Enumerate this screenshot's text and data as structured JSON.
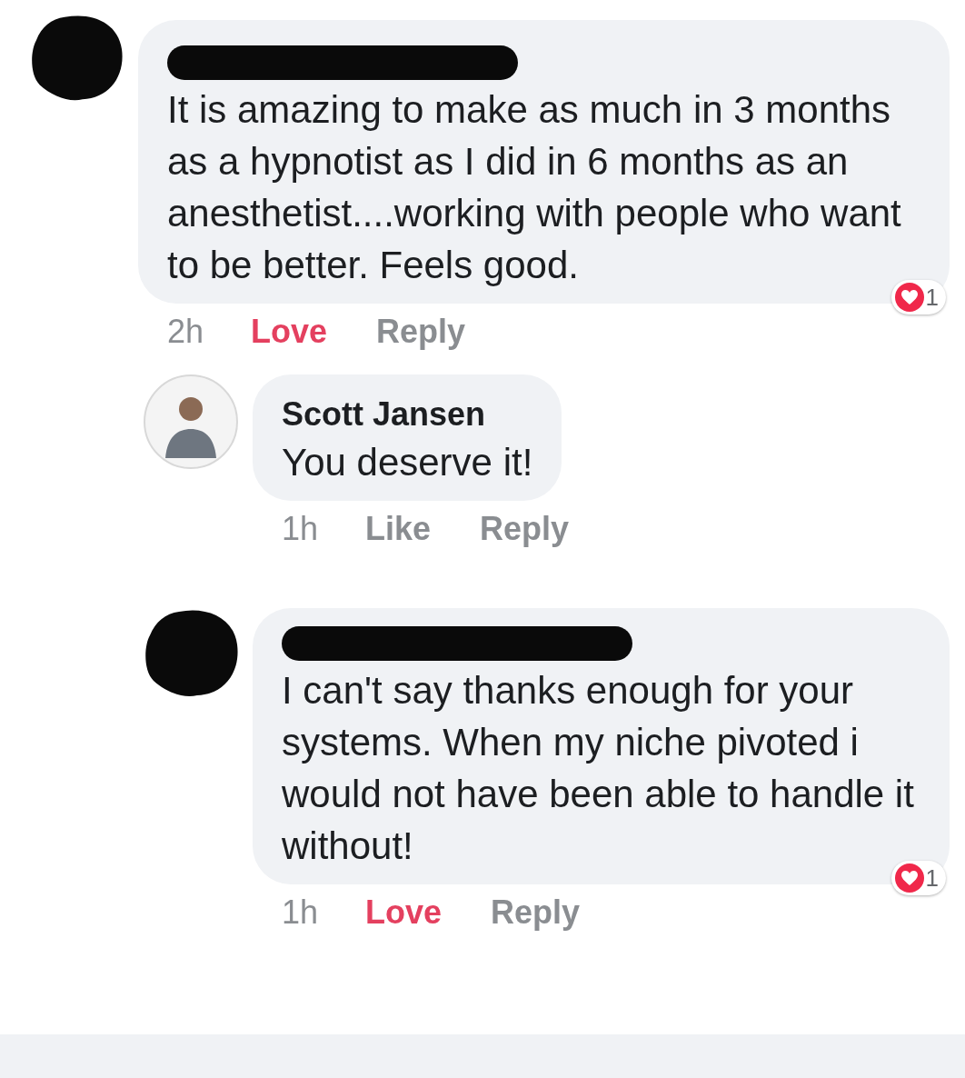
{
  "comments": [
    {
      "name_hidden": true,
      "avatar_hidden": true,
      "text": "It is amazing to make as much in 3 months as a hypnotist as I did in 6 months as an anesthetist....working with people who want to be better.  Feels good.",
      "time": "2h",
      "reaction_label": "Love",
      "reacted": true,
      "reply_label": "Reply",
      "reaction_count": "1",
      "children": [
        {
          "name_hidden": false,
          "avatar_hidden": false,
          "author": "Scott Jansen",
          "text": "You deserve it!",
          "time": "1h",
          "reaction_label": "Like",
          "reacted": false,
          "reply_label": "Reply"
        },
        {
          "name_hidden": true,
          "avatar_hidden": true,
          "text": "I can't say thanks enough for your systems. When my niche pivoted i would not have been able to handle it without!",
          "time": "1h",
          "reaction_label": "Love",
          "reacted": true,
          "reply_label": "Reply",
          "reaction_count": "1"
        }
      ]
    }
  ]
}
